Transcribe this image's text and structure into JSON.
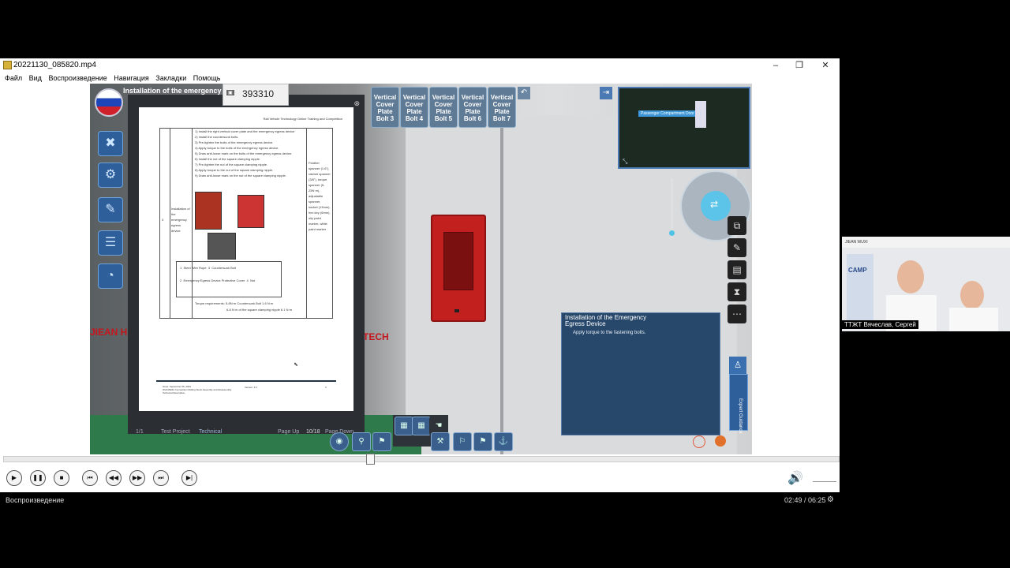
{
  "window": {
    "title": "20221130_085820.mp4",
    "minimize": "–",
    "maximize": "❐",
    "close": "✕"
  },
  "menu": [
    "Файл",
    "Вид",
    "Воспроизведение",
    "Навигация",
    "Закладки",
    "Помощь"
  ],
  "video": {
    "scene_title": "Installation of the emergency egres",
    "code_badge": "393310",
    "bolt_buttons": [
      "Vertical Cover Plate Bolt 3",
      "Vertical Cover Plate Bolt 4",
      "Vertical Cover Plate Bolt 5",
      "Vertical Cover Plate Bolt 6",
      "Vertical Cover Plate Bolt 7"
    ],
    "sign_left": "JIEAN H",
    "sign_right": "-TECH",
    "minimap_label": "Passenger Compartment Door",
    "document": {
      "header": "Rail Vehicle Technology Online Training and Competition",
      "steps": [
        "1) Install the right vertical cover plate and the emergency egress device",
        "2) Install the countersunk bolts.",
        "3) Pre-tighten the bolts of the emergency egress device.",
        "4) Apply torque to the bolts of the emergency egress device.",
        "5) Draw anti-loose mark on the bolts of the emergency egress device.",
        "6) Install the nut of the square clamping nipple.",
        "7) Pre-tighten the nut of the square clamping nipple.",
        "8) Apply torque to the nut of the square clamping nipple.",
        "9) Draw anti-loose mark on the nut of the square clamping nipple."
      ],
      "row_label": "Installation of the emergency egress device",
      "row_number": "3",
      "tools_text": "Feather spanner (1.6\"), ratchet spanner (3/8\"), torque spanner (5-25N·m), adjustable spanner, socket (13mm), hex key (6mm), oily paint marker, white paint marker",
      "small_table": [
        [
          "1",
          "Steel Wire Rope",
          "3",
          "Countersunk Bolt"
        ],
        [
          "2",
          "Emergency Egress Device Protective Cover",
          "4",
          "Nut"
        ]
      ],
      "torque_line1": "Torque requirements: 5-8N·m Countersunk Bolt 1.6 N·m",
      "torque_line2": "6-8 N·m of the square clamping nipple 6.1 N·m",
      "footer_left": "Issue: September 06, 2022\nWorldSkills Competition Rolling Stock Assembly and Disassembly Technical Description",
      "footer_mid": "Version: 3.0",
      "footer_right": "3",
      "nav": {
        "page_count": "1/1",
        "tab_test": "Test Project",
        "tab_technical": "Technical",
        "page_up": "Page Up",
        "page_pos": "10/18",
        "page_down": "Page Down"
      }
    },
    "instruction": {
      "title": "Installation of the Emergency Egress Device",
      "body": "Apply torque to the fastening bolts."
    },
    "expert_guidance": "Expert Guidance"
  },
  "controls": {
    "play": "▶",
    "pause": "❚❚",
    "stop": "■",
    "prev": "⏮",
    "rewind": "◀◀",
    "forward": "▶▶",
    "next": "⏭",
    "frame": "▶|",
    "volume_icon": "🔊"
  },
  "status": {
    "left": "Воспроизведение",
    "time": "02:49 / 06:25",
    "progress": 0.438
  },
  "webcam": {
    "caption": "ТТЖТ Вячеслав, Сергей",
    "banner": "JIEAN WUXI",
    "camp": "CAMP"
  }
}
